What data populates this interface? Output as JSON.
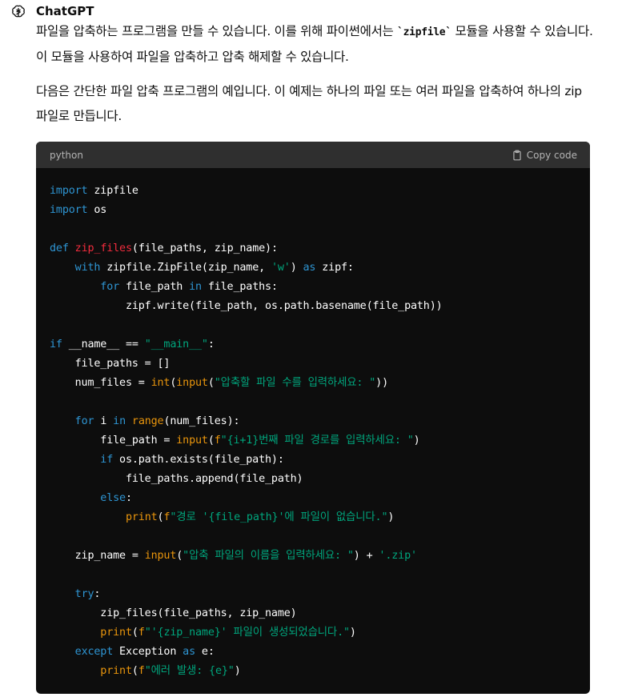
{
  "message": {
    "author": "ChatGPT",
    "para1": {
      "before": "파일을 압축하는 프로그램을 만들 수 있습니다. 이를 위해 파이썬에서는 ",
      "code": "`zipfile`",
      "after": " 모듈을 사용할 수 있습니다. 이 모듈을 사용하여 파일을 압축하고 압축 해제할 수 있습니다."
    },
    "para2": "다음은 간단한 파일 압축 프로그램의 예입니다. 이 예제는 하나의 파일 또는 여러 파일을 압축하여 하나의 zip 파일로 만듭니다."
  },
  "codeblock": {
    "language": "python",
    "copy_label": "Copy code",
    "lines": [
      [
        [
          "kw",
          "import"
        ],
        [
          "pl",
          " zipfile"
        ]
      ],
      [
        [
          "kw",
          "import"
        ],
        [
          "pl",
          " os"
        ]
      ],
      [],
      [
        [
          "kw",
          "def"
        ],
        [
          "pl",
          " "
        ],
        [
          "fn",
          "zip_files"
        ],
        [
          "pl",
          "(file_paths, zip_name):"
        ]
      ],
      [
        [
          "pl",
          "    "
        ],
        [
          "kw",
          "with"
        ],
        [
          "pl",
          " zipfile.ZipFile(zip_name, "
        ],
        [
          "st",
          "'w'"
        ],
        [
          "pl",
          ") "
        ],
        [
          "kw",
          "as"
        ],
        [
          "pl",
          " zipf:"
        ]
      ],
      [
        [
          "pl",
          "        "
        ],
        [
          "kw",
          "for"
        ],
        [
          "pl",
          " file_path "
        ],
        [
          "kw",
          "in"
        ],
        [
          "pl",
          " file_paths:"
        ]
      ],
      [
        [
          "pl",
          "            zipf.write(file_path, os.path.basename(file_path))"
        ]
      ],
      [],
      [
        [
          "kw",
          "if"
        ],
        [
          "pl",
          " __name__ == "
        ],
        [
          "st",
          "\"__main__\""
        ],
        [
          "pl",
          ":"
        ]
      ],
      [
        [
          "pl",
          "    file_paths = []"
        ]
      ],
      [
        [
          "pl",
          "    num_files = "
        ],
        [
          "bi",
          "int"
        ],
        [
          "pl",
          "("
        ],
        [
          "bi",
          "input"
        ],
        [
          "pl",
          "("
        ],
        [
          "st",
          "\"압축할 파일 수를 입력하세요: \""
        ],
        [
          "pl",
          "))"
        ]
      ],
      [],
      [
        [
          "pl",
          "    "
        ],
        [
          "kw",
          "for"
        ],
        [
          "pl",
          " i "
        ],
        [
          "kw",
          "in"
        ],
        [
          "pl",
          " "
        ],
        [
          "bi",
          "range"
        ],
        [
          "pl",
          "(num_files):"
        ]
      ],
      [
        [
          "pl",
          "        file_path = "
        ],
        [
          "bi",
          "input"
        ],
        [
          "pl",
          "("
        ],
        [
          "bi",
          "f"
        ],
        [
          "st",
          "\"{i+1}번째 파일 경로를 입력하세요: \""
        ],
        [
          "pl",
          ")"
        ]
      ],
      [
        [
          "pl",
          "        "
        ],
        [
          "kw",
          "if"
        ],
        [
          "pl",
          " os.path.exists(file_path):"
        ]
      ],
      [
        [
          "pl",
          "            file_paths.append(file_path)"
        ]
      ],
      [
        [
          "pl",
          "        "
        ],
        [
          "kw",
          "else"
        ],
        [
          "pl",
          ":"
        ]
      ],
      [
        [
          "pl",
          "            "
        ],
        [
          "bi",
          "print"
        ],
        [
          "pl",
          "("
        ],
        [
          "bi",
          "f"
        ],
        [
          "st",
          "\"경로 '{file_path}'에 파일이 없습니다.\""
        ],
        [
          "pl",
          ")"
        ]
      ],
      [],
      [
        [
          "pl",
          "    zip_name = "
        ],
        [
          "bi",
          "input"
        ],
        [
          "pl",
          "("
        ],
        [
          "st",
          "\"압축 파일의 이름을 입력하세요: \""
        ],
        [
          "pl",
          ") + "
        ],
        [
          "st",
          "'.zip'"
        ]
      ],
      [],
      [
        [
          "pl",
          "    "
        ],
        [
          "kw",
          "try"
        ],
        [
          "pl",
          ":"
        ]
      ],
      [
        [
          "pl",
          "        zip_files(file_paths, zip_name)"
        ]
      ],
      [
        [
          "pl",
          "        "
        ],
        [
          "bi",
          "print"
        ],
        [
          "pl",
          "("
        ],
        [
          "bi",
          "f"
        ],
        [
          "st",
          "\"'{zip_name}' 파일이 생성되었습니다.\""
        ],
        [
          "pl",
          ")"
        ]
      ],
      [
        [
          "pl",
          "    "
        ],
        [
          "kw",
          "except"
        ],
        [
          "pl",
          " Exception "
        ],
        [
          "kw",
          "as"
        ],
        [
          "pl",
          " e:"
        ]
      ],
      [
        [
          "pl",
          "        "
        ],
        [
          "bi",
          "print"
        ],
        [
          "pl",
          "("
        ],
        [
          "bi",
          "f"
        ],
        [
          "st",
          "\"에러 발생: {e}\""
        ],
        [
          "pl",
          ")"
        ]
      ]
    ]
  },
  "icons": {
    "avatar": "openai-logo-icon",
    "copy": "clipboard-icon"
  },
  "colors": {
    "keyword": "#2e95d3",
    "function": "#f22c3d",
    "builtin": "#e9950c",
    "string": "#00a67d",
    "code_bg": "#0d0d0d",
    "code_header_bg": "#2f2f2f"
  }
}
